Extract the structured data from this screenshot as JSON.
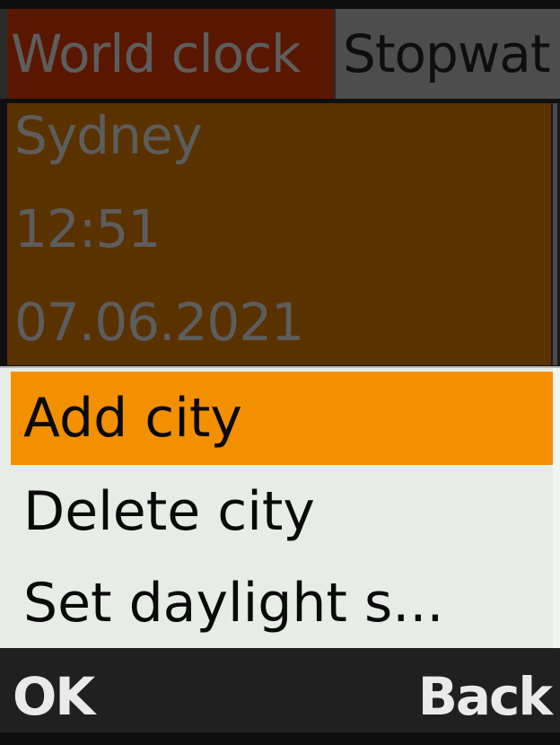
{
  "tabs": [
    {
      "label": "World clock",
      "active": true
    },
    {
      "label": "Stopwat",
      "active": false
    }
  ],
  "city_card": {
    "city": "Sydney",
    "time": "12:51",
    "date": "07.06.2021"
  },
  "menu": {
    "items": [
      {
        "label": "Add city",
        "selected": true
      },
      {
        "label": "Delete city",
        "selected": false
      },
      {
        "label": "Set daylight s...",
        "selected": false
      }
    ]
  },
  "softkeys": {
    "left": "OK",
    "right": "Back"
  },
  "colors": {
    "active_tab": "#5a1700",
    "inactive_tab": "#4d4d4d",
    "card_background": "#5a3200",
    "menu_background": "#e7ece7",
    "selection": "#f29000",
    "softkey_bar": "#202020"
  }
}
